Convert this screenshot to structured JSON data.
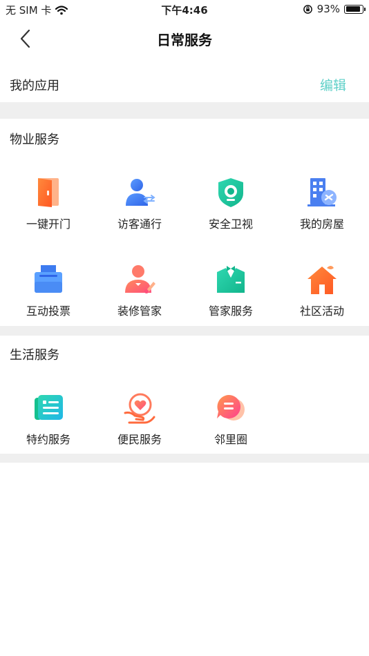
{
  "status_bar": {
    "carrier": "无 SIM 卡",
    "time": "下午4:46",
    "battery": "93%",
    "battery_level": 0.93
  },
  "nav": {
    "title": "日常服务",
    "back_icon": "chevron-left-icon"
  },
  "my_apps": {
    "title": "我的应用",
    "edit_label": "编辑"
  },
  "property_services": {
    "title": "物业服务",
    "items": [
      {
        "label": "一键开门",
        "icon": "door-icon"
      },
      {
        "label": "访客通行",
        "icon": "visitor-icon"
      },
      {
        "label": "安全卫视",
        "icon": "camera-icon"
      },
      {
        "label": "我的房屋",
        "icon": "building-icon"
      },
      {
        "label": "互动投票",
        "icon": "ballot-box-icon"
      },
      {
        "label": "装修管家",
        "icon": "decorator-icon"
      },
      {
        "label": "管家服务",
        "icon": "butler-icon"
      },
      {
        "label": "社区活动",
        "icon": "house-icon"
      }
    ]
  },
  "life_services": {
    "title": "生活服务",
    "items": [
      {
        "label": "特约服务",
        "icon": "news-icon"
      },
      {
        "label": "便民服务",
        "icon": "heart-hand-icon"
      },
      {
        "label": "邻里圈",
        "icon": "chat-icon"
      }
    ]
  },
  "colors": {
    "accent": "#5fd0c8",
    "divider": "#efefef",
    "orange": "#ff6a2e",
    "blue": "#3d7bf0",
    "teal": "#19c9a0",
    "pink": "#ff5a8a"
  }
}
